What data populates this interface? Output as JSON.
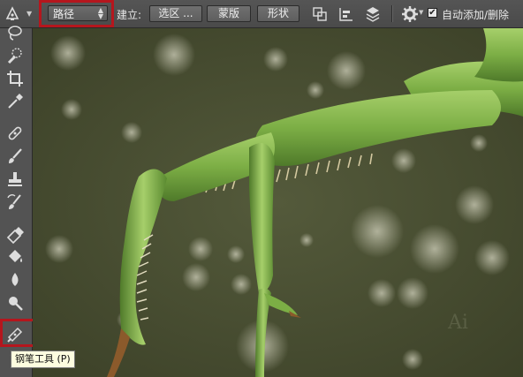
{
  "options_bar": {
    "mode_value": "路径",
    "make_label": "建立:",
    "selection_button": "选区 ...",
    "mask_button": "蒙版",
    "shape_button": "形状",
    "auto_add_delete_label": "自动添加/删除",
    "auto_add_delete_checked": true
  },
  "tools": [
    "lasso-tool",
    "quick-selection-tool",
    "crop-tool",
    "eyedropper-tool",
    "spot-healing-brush-tool",
    "brush-tool",
    "clone-stamp-tool",
    "history-brush-tool",
    "eraser-tool",
    "paint-bucket-tool",
    "blur-tool",
    "dodge-tool",
    "pen-tool"
  ],
  "tooltip": {
    "text": "钢笔工具 (P)"
  },
  "colors": {
    "highlight": "#b5161d",
    "canvas_bg": "#454a2f",
    "mantis_green": "#7fae47"
  }
}
